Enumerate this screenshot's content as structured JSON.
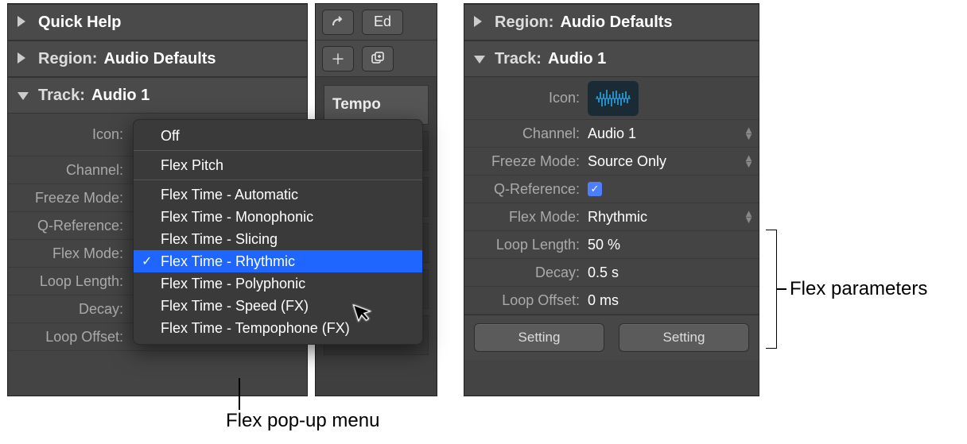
{
  "left": {
    "quick_help": "Quick Help",
    "region_label": "Region:",
    "region_value": "Audio Defaults",
    "track_label": "Track:",
    "track_value": "Audio 1",
    "rows": {
      "icon": "Icon:",
      "channel": "Channel:",
      "freeze": "Freeze Mode:",
      "qref": "Q-Reference:",
      "flex": "Flex Mode:",
      "loop_len": "Loop Length:",
      "decay": "Decay:",
      "loop_off": "Loop Offset:"
    }
  },
  "mid": {
    "edit": "Ed",
    "tempo": "Tempo"
  },
  "right": {
    "region_label": "Region:",
    "region_value": "Audio Defaults",
    "track_label": "Track:",
    "track_value": "Audio 1",
    "rows": {
      "icon": "Icon:",
      "channel_l": "Channel:",
      "channel_v": "Audio 1",
      "freeze_l": "Freeze Mode:",
      "freeze_v": "Source Only",
      "qref_l": "Q-Reference:",
      "flex_l": "Flex Mode:",
      "flex_v": "Rhythmic",
      "loop_len_l": "Loop Length:",
      "loop_len_v": "50 %",
      "decay_l": "Decay:",
      "decay_v": "0.5 s",
      "loop_off_l": "Loop Offset:",
      "loop_off_v": "0 ms"
    },
    "setting": "Setting"
  },
  "popup": {
    "items": [
      "Off",
      "Flex Pitch",
      "Flex Time - Automatic",
      "Flex Time - Monophonic",
      "Flex Time - Slicing",
      "Flex Time - Rhythmic",
      "Flex Time - Polyphonic",
      "Flex Time - Speed (FX)",
      "Flex Time - Tempophone (FX)"
    ],
    "selected_index": 5
  },
  "callouts": {
    "popup": "Flex pop-up menu",
    "params": "Flex parameters"
  }
}
